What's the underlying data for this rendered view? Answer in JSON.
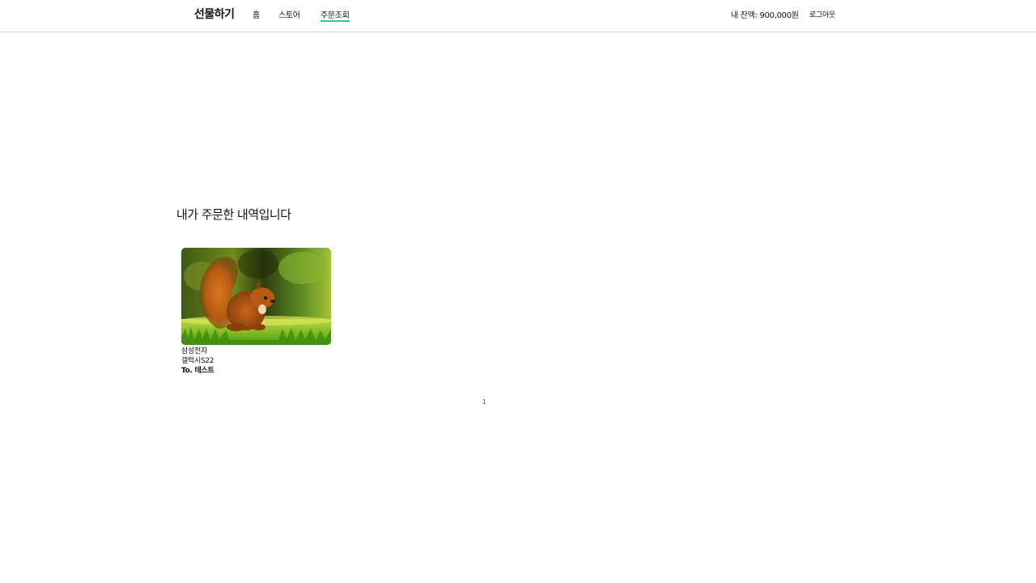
{
  "header": {
    "brand": "선물하기",
    "nav": [
      {
        "label": "홈"
      },
      {
        "label": "스토어"
      },
      {
        "label": "주문조회"
      }
    ],
    "active_nav": "주문조회",
    "balance_text": "내 잔액: 900,000원",
    "logout_label": "로그아웃",
    "accent_color": "#2ac1bc"
  },
  "main": {
    "title": "내가 주문한 내역입니다",
    "orders": [
      {
        "image_icon": "squirrel-photo",
        "brand": "삼성전자",
        "product": "갤럭시S22",
        "recipient": "To. 테스트"
      }
    ]
  },
  "pagination": {
    "current_page": "1"
  }
}
